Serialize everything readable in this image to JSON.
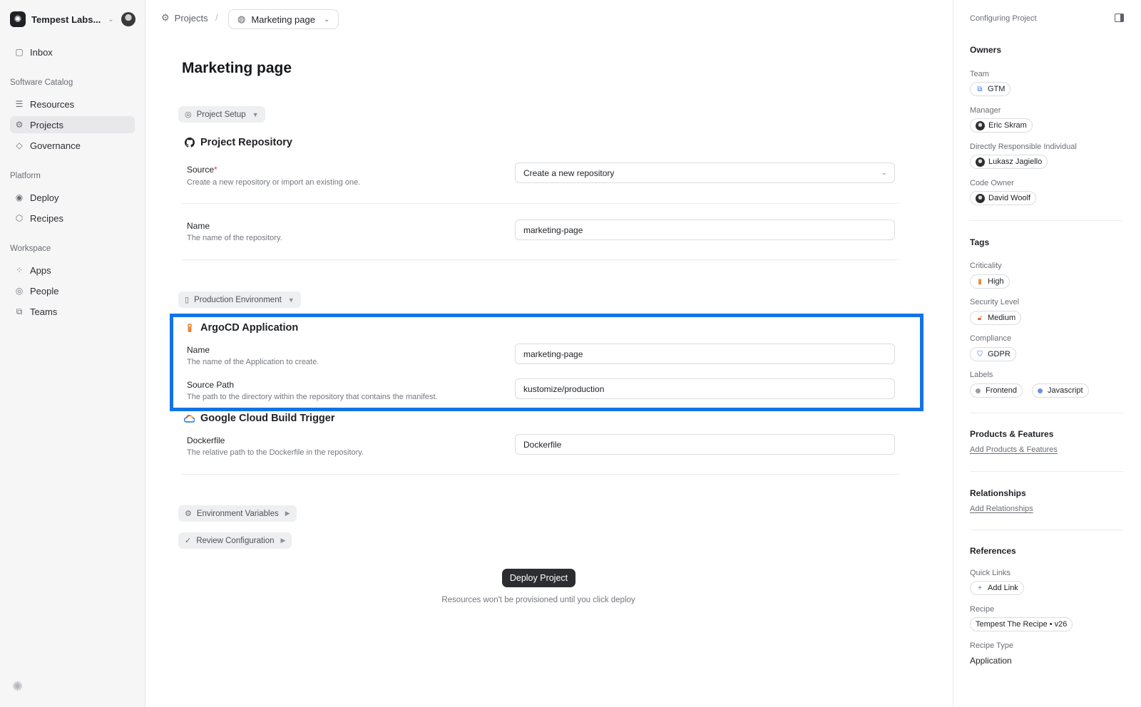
{
  "sidebar": {
    "workspace_name": "Tempest Labs...",
    "items": [
      {
        "label": "Inbox",
        "icon": "inbox-icon"
      },
      {
        "label": "Resources",
        "icon": "list-icon"
      },
      {
        "label": "Projects",
        "icon": "gear-icon",
        "active": true
      },
      {
        "label": "Governance",
        "icon": "diamond-icon"
      },
      {
        "label": "Deploy",
        "icon": "broadcast-icon"
      },
      {
        "label": "Recipes",
        "icon": "box-icon"
      },
      {
        "label": "Apps",
        "icon": "dots-grid-icon"
      },
      {
        "label": "People",
        "icon": "person-circle-icon"
      },
      {
        "label": "Teams",
        "icon": "teams-icon"
      }
    ],
    "sections": {
      "catalog": "Software Catalog",
      "platform": "Platform",
      "workspace": "Workspace"
    }
  },
  "breadcrumb": {
    "root": "Projects",
    "separator": "/",
    "current": "Marketing page"
  },
  "main": {
    "title": "Marketing page",
    "project_setup_pill": "Project Setup",
    "repo": {
      "title": "Project Repository",
      "source_label": "Source",
      "source_required_mark": "*",
      "source_desc": "Create a new repository or import an existing one.",
      "source_value": "Create a new repository",
      "name_label": "Name",
      "name_desc": "The name of the repository.",
      "name_value": "marketing-page"
    },
    "production_pill": "Production Environment",
    "argocd": {
      "title": "ArgoCD Application",
      "name_label": "Name",
      "name_desc": "The name of the Application to create.",
      "name_value": "marketing-page",
      "path_label": "Source Path",
      "path_desc": "The path to the directory within the repository that contains the manifest.",
      "path_value": "kustomize/production"
    },
    "gcb": {
      "title": "Google Cloud Build Trigger",
      "dockerfile_label": "Dockerfile",
      "dockerfile_desc": "The relative path to the Dockerfile in the repository.",
      "dockerfile_value": "Dockerfile"
    },
    "env_pill": "Environment Variables",
    "review_pill": "Review Configuration",
    "deploy_button": "Deploy Project",
    "deploy_note": "Resources won't be provisioned until you click deploy"
  },
  "right_panel": {
    "header": "Configuring Project",
    "owners": {
      "title": "Owners",
      "team_label": "Team",
      "team_value": "GTM",
      "manager_label": "Manager",
      "manager_value": "Eric Skram",
      "dri_label": "Directly Responsible Individual",
      "dri_value": "Lukasz Jagiello",
      "code_owner_label": "Code Owner",
      "code_owner_value": "David Woolf"
    },
    "tags": {
      "title": "Tags",
      "criticality_label": "Criticality",
      "criticality_value": "High",
      "security_label": "Security Level",
      "security_value": "Medium",
      "compliance_label": "Compliance",
      "compliance_value": "GDPR",
      "labels_label": "Labels",
      "labels": [
        "Frontend",
        "Javascript"
      ]
    },
    "products": {
      "title": "Products & Features",
      "link": "Add Products & Features"
    },
    "relationships": {
      "title": "Relationships",
      "link": "Add Relationships"
    },
    "references": {
      "title": "References",
      "quick_links_label": "Quick Links",
      "add_link": "Add Link",
      "recipe_label": "Recipe",
      "recipe_value": "Tempest The Recipe • v26",
      "recipe_type_label": "Recipe Type",
      "recipe_type_value": "Application"
    }
  },
  "colors": {
    "highlight": "#1473e6",
    "primary_button": "#2b2d31",
    "required": "#e0413b",
    "criticality_high": "#e8873a",
    "security_medium": "#e06a3a",
    "compliance_gdpr": "#2f6fe0",
    "label_frontend": "#9a9ca3",
    "label_javascript": "#6d8fe8"
  }
}
